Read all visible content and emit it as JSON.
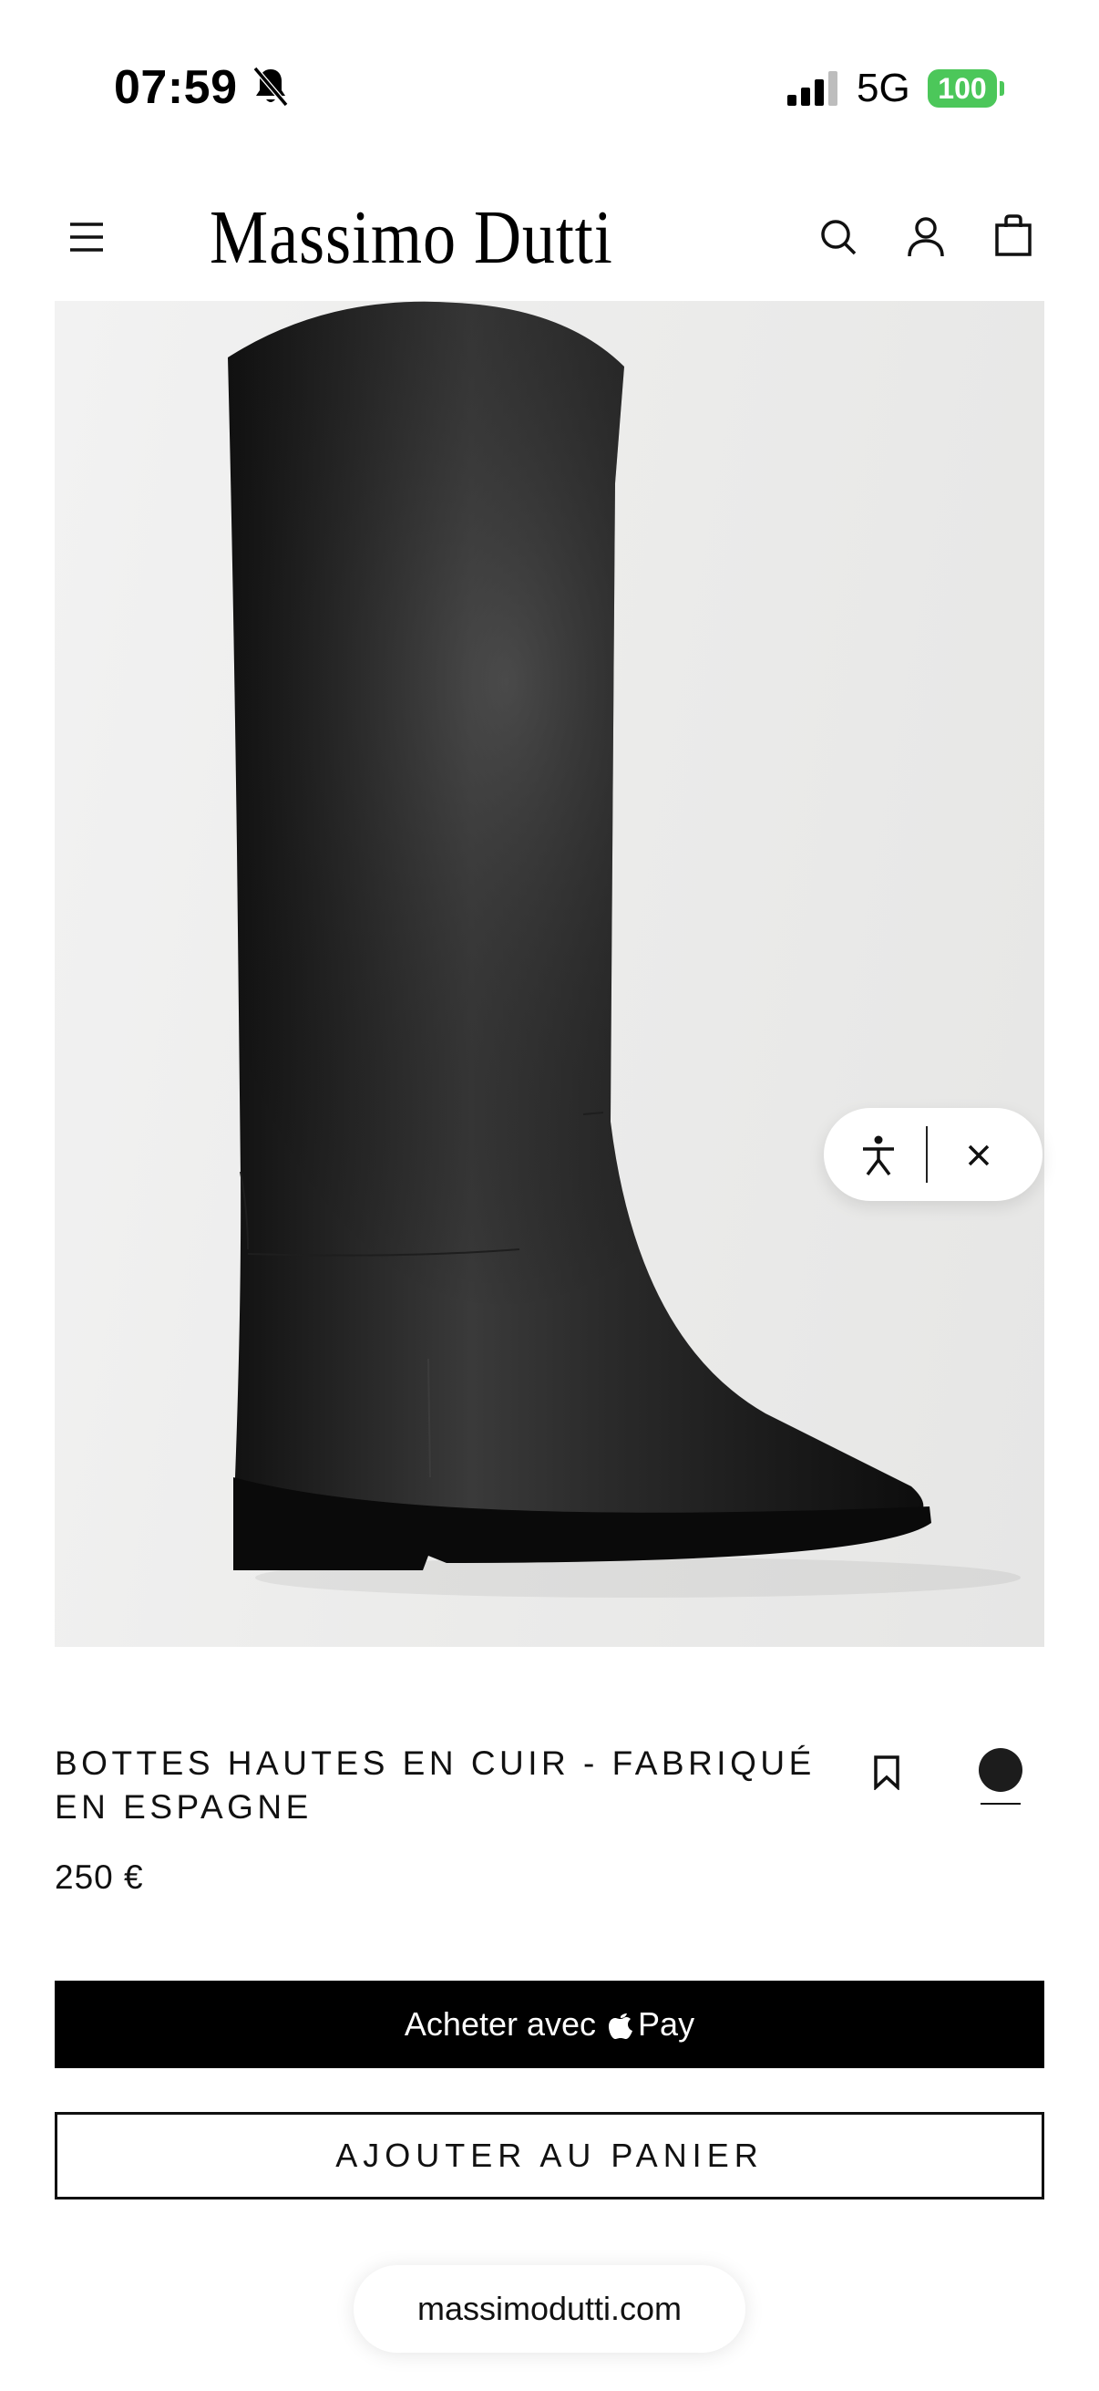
{
  "status_bar": {
    "time": "07:59",
    "network": "5G",
    "battery": "100",
    "battery_color": "#4cc75a",
    "icons": [
      "bell-muted-icon",
      "signal-icon",
      "battery-icon"
    ]
  },
  "header": {
    "brand": "Massimo Dutti",
    "icons": [
      "menu-icon",
      "search-icon",
      "account-icon",
      "shopping-bag-icon"
    ]
  },
  "product": {
    "image_subject": "black leather boot",
    "title": "BOTTES HAUTES EN CUIR - FABRIQUÉ EN ESPAGNE",
    "price": "250 €",
    "selected_color": "#1c1c1c",
    "icons": [
      "bookmark-icon"
    ]
  },
  "accessibility_widget": {
    "icons": [
      "accessibility-icon",
      "close-icon"
    ]
  },
  "actions": {
    "apple_pay_prefix": "Acheter avec",
    "apple_pay_suffix": "Pay",
    "apple_pay_color": "#000000",
    "add_to_cart": "AJOUTER AU PANIER"
  },
  "browser": {
    "url": "massimodutti.com"
  }
}
